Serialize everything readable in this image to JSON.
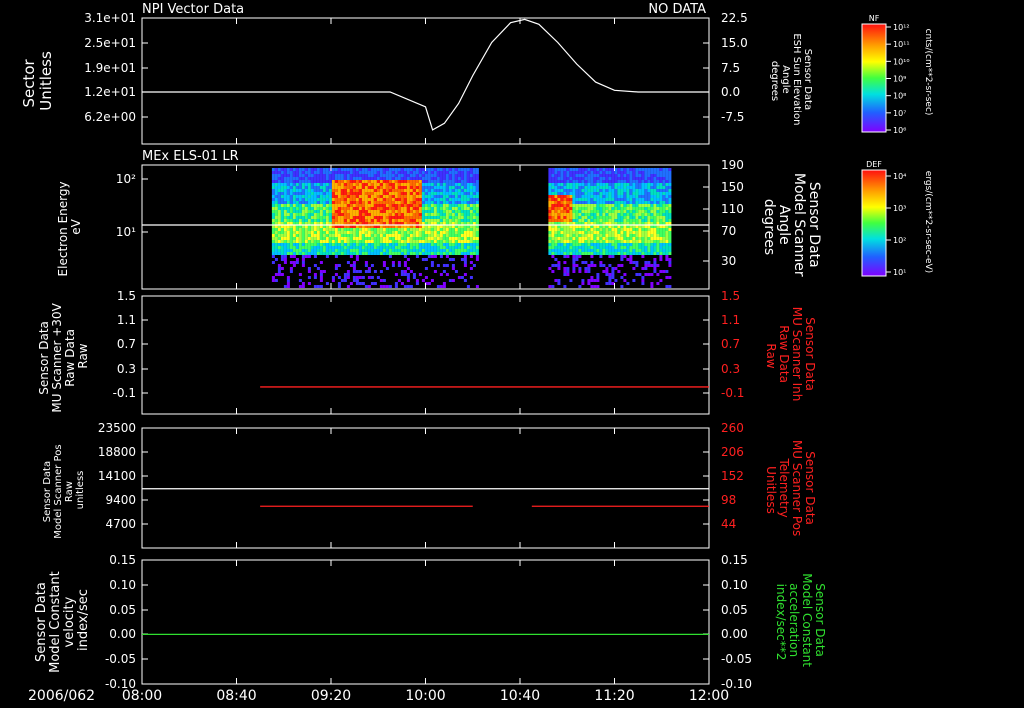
{
  "date_label": "2006/062",
  "x_ticks": [
    "08:00",
    "08:40",
    "09:20",
    "10:00",
    "10:40",
    "11:20",
    "12:00"
  ],
  "panels": [
    {
      "title_left": "NPI Vector Data",
      "title_right": "NO DATA",
      "ylabel_left": [
        "Sector",
        "Unitless"
      ],
      "ylabel_right": [
        "Sensor Data",
        "ESH Sun Elevation",
        "Angle",
        "degrees"
      ],
      "left_ticks": [
        "3.1e+01",
        "2.5e+01",
        "1.9e+01",
        "1.2e+01",
        "6.2e+00"
      ],
      "right_ticks": [
        "22.5",
        "15.0",
        "7.5",
        "0.0",
        "-7.5"
      ]
    },
    {
      "title_left": "MEx ELS-01 LR",
      "ylabel_left": [
        "Electron Energy",
        "eV"
      ],
      "ylabel_right": [
        "Sensor Data",
        "Model Scanner",
        "Angle",
        "degrees"
      ],
      "left_ticks": [
        "10²",
        "10¹"
      ],
      "right_ticks": [
        "190",
        "150",
        "110",
        "70",
        "30"
      ]
    },
    {
      "ylabel_left": [
        "Sensor Data",
        "MU Scanner +30V",
        "Raw Data",
        "Raw"
      ],
      "ylabel_right": [
        "Sensor Data",
        "MU Scanner Inh",
        "Raw Data",
        "Raw"
      ],
      "left_ticks": [
        "1.5",
        "1.1",
        "0.7",
        "0.3",
        "-0.1"
      ],
      "right_ticks": [
        "1.5",
        "1.1",
        "0.7",
        "0.3",
        "-0.1"
      ]
    },
    {
      "ylabel_left": [
        "Sensor Data",
        "Model Scanner Pos",
        "Raw",
        "unitless"
      ],
      "ylabel_right": [
        "Sensor Data",
        "MU Scanner Pos",
        "Telemetry",
        "Unitless"
      ],
      "left_ticks": [
        "23500",
        "18800",
        "14100",
        "9400",
        "4700"
      ],
      "right_ticks": [
        "260",
        "206",
        "152",
        "98",
        "44"
      ]
    },
    {
      "ylabel_left": [
        "Sensor Data",
        "Model Constant",
        "velocity",
        "index/sec"
      ],
      "ylabel_right": [
        "Sensor Data",
        "Model Constant",
        "acceleration",
        "index/sec**2"
      ],
      "left_ticks": [
        "0.15",
        "0.10",
        "0.05",
        "0.00",
        "-0.05",
        "-0.10"
      ],
      "right_ticks": [
        "0.15",
        "0.10",
        "0.05",
        "0.00",
        "-0.05",
        "-0.10"
      ]
    }
  ],
  "colorbars": [
    {
      "title": "NF",
      "unit": "cnts/(cm**2-sr-sec)",
      "ticks": [
        "10¹²",
        "10¹¹",
        "10¹⁰",
        "10⁹",
        "10⁸",
        "10⁷",
        "10⁶"
      ]
    },
    {
      "title": "DEF",
      "unit": "ergs/(cm**2-sr-sec-eV)",
      "ticks": [
        "10⁴",
        "10³",
        "10²",
        "10¹"
      ]
    }
  ],
  "colors": {
    "background": "#000000",
    "foreground": "#ffffff",
    "red_axis": "#ff2020",
    "green_axis": "#30e030"
  },
  "chart_data": {
    "type": "line",
    "x_range": [
      "08:00",
      "12:00"
    ],
    "panels": [
      {
        "name": "ESH Sun Elevation Angle",
        "ylim_right": [
          -15,
          22.5
        ],
        "series": [
          {
            "x": [
              "08:00",
              "08:45",
              "09:00",
              "09:45",
              "10:00",
              "10:03",
              "10:08",
              "10:14",
              "10:20",
              "10:28",
              "10:36",
              "10:42",
              "10:48",
              "10:56",
              "11:04",
              "11:12",
              "11:20",
              "11:30",
              "12:00"
            ],
            "y": [
              0.0,
              0.0,
              0.0,
              0.0,
              -4.5,
              -11.5,
              -9.5,
              -3.5,
              5.0,
              15.0,
              21.0,
              22.0,
              20.5,
              15.0,
              8.5,
              3.0,
              0.5,
              0.0,
              0.0
            ]
          }
        ]
      },
      {
        "name": "MEx ELS-01 LR spectrogram",
        "type": "heatmap",
        "data_intervals": [
          [
            "08:55",
            "10:22"
          ],
          [
            "10:52",
            "11:44"
          ]
        ],
        "reference_line_right": 100
      },
      {
        "name": "MU Scanner Inh Raw Data",
        "ylim": [
          -0.3,
          1.5
        ],
        "series": [
          {
            "x": [
              "08:50",
              "12:00"
            ],
            "y": [
              0.0,
              0.0
            ],
            "color": "#ff2020"
          }
        ]
      },
      {
        "name": "Scanner Position",
        "ylim_left": [
          0,
          23500
        ],
        "ylim_right": [
          20,
          260
        ],
        "series": [
          {
            "x": [
              "08:00",
              "12:00"
            ],
            "y": [
              11600,
              11600
            ],
            "color": "#ffffff",
            "axis": "left"
          },
          {
            "x": [
              "08:50",
              "10:20"
            ],
            "y": [
              84,
              84
            ],
            "color": "#ff2020",
            "axis": "right"
          },
          {
            "x": [
              "10:45",
              "12:00"
            ],
            "y": [
              84,
              84
            ],
            "color": "#ff2020",
            "axis": "right"
          }
        ]
      },
      {
        "name": "Model Constant",
        "ylim": [
          -0.1,
          0.15
        ],
        "series": [
          {
            "x": [
              "08:00",
              "12:00"
            ],
            "y": [
              0.0,
              0.0
            ],
            "color": "#30e030"
          }
        ]
      }
    ]
  }
}
